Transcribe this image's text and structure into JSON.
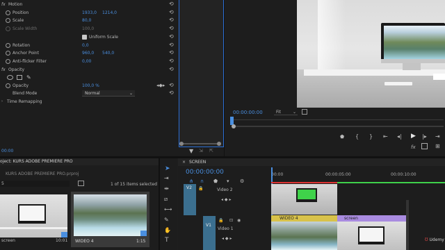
{
  "effect_controls": {
    "motion": "Motion",
    "position": {
      "label": "Position",
      "x": "1933,0",
      "y": "1214,0"
    },
    "scale": {
      "label": "Scale",
      "value": "80,0"
    },
    "scale_width": {
      "label": "Scale Width",
      "value": "100,0"
    },
    "uniform_scale": "Uniform Scale",
    "rotation": {
      "label": "Rotation",
      "value": "0,0"
    },
    "anchor_point": {
      "label": "Anchor Point",
      "x": "960,0",
      "y": "540,0"
    },
    "anti_flicker": {
      "label": "Anti-flicker Filter",
      "value": "0,00"
    },
    "opacity_section": "Opacity",
    "opacity": {
      "label": "Opacity",
      "value": "100,0 %"
    },
    "blend_mode": {
      "label": "Blend Mode",
      "value": "Normal"
    },
    "time_remapping": "Time Remapping",
    "timecode": "00:00"
  },
  "program_monitor": {
    "timecode": "00:00:00:00",
    "fit": "Fit"
  },
  "project": {
    "title": "oject: KURS ADOBE PREMIERE PRO",
    "file": "KURS ADOBE PREMIERE PRO.prproj",
    "search_value": "5",
    "items_status": "1 of 15 items selected",
    "clips": [
      {
        "name": "screen",
        "duration": "10:01"
      },
      {
        "name": "WIDEO 4",
        "duration": "1:15"
      }
    ]
  },
  "timeline": {
    "tab": "SCREEN",
    "timecode": "00:00:00:00",
    "ruler": [
      "00:00",
      "00:00:05:00",
      "00:00:10:00"
    ],
    "tracks": [
      {
        "id": "V2",
        "name": "Video 2"
      },
      {
        "id": "V1",
        "name": "Video 1"
      }
    ],
    "clip_labels": [
      "WIDEO 4",
      "screen"
    ]
  },
  "udemy": "Udemy",
  "colors": {
    "accent_blue": "#2b6fd6",
    "timecode_blue": "#4a8fe0",
    "clip_green": "#3fd24a",
    "clip_purple": "#a98be0",
    "clip_yellow": "#d8c24a"
  }
}
